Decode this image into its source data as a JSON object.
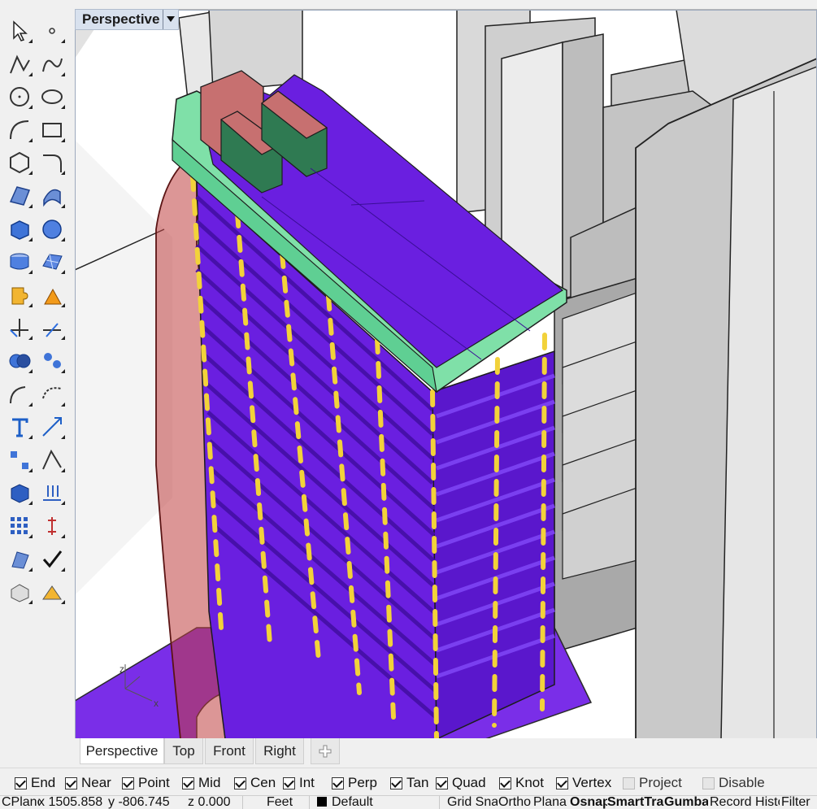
{
  "viewport": {
    "title": "Perspective"
  },
  "toolbar": {
    "tools": [
      {
        "icon": "select-arrow-icon"
      },
      {
        "icon": "point-icon"
      },
      {
        "icon": "polyline-icon"
      },
      {
        "icon": "curve-icon"
      },
      {
        "icon": "circle-icon"
      },
      {
        "icon": "ellipse-icon"
      },
      {
        "icon": "arc-icon"
      },
      {
        "icon": "rectangle-icon"
      },
      {
        "icon": "polygon-icon"
      },
      {
        "icon": "fillet-curve-icon"
      },
      {
        "icon": "surface-icon"
      },
      {
        "icon": "loft-icon"
      },
      {
        "icon": "box-icon"
      },
      {
        "icon": "sphere-icon"
      },
      {
        "icon": "cylinder-icon"
      },
      {
        "icon": "mesh-icon"
      },
      {
        "icon": "puzzle-icon"
      },
      {
        "icon": "explode-icon"
      },
      {
        "icon": "trim-icon"
      },
      {
        "icon": "split-icon"
      },
      {
        "icon": "boolean-icon"
      },
      {
        "icon": "array-icon"
      },
      {
        "icon": "offset-icon"
      },
      {
        "icon": "rotate-icon"
      },
      {
        "icon": "text-icon"
      },
      {
        "icon": "scale-icon"
      },
      {
        "icon": "group-icon"
      },
      {
        "icon": "transform-icon"
      },
      {
        "icon": "solid-edit-icon"
      },
      {
        "icon": "extrude-icon"
      },
      {
        "icon": "grid-array-icon"
      },
      {
        "icon": "dimension-icon"
      },
      {
        "icon": "analyze-icon"
      },
      {
        "icon": "check-icon"
      },
      {
        "icon": "render-icon"
      },
      {
        "icon": "light-icon"
      }
    ]
  },
  "tabs": [
    {
      "label": "Perspective",
      "active": true
    },
    {
      "label": "Top",
      "active": false
    },
    {
      "label": "Front",
      "active": false
    },
    {
      "label": "Right",
      "active": false
    }
  ],
  "add_tab_icon": "plus-icon",
  "osnaps": [
    {
      "label": "End",
      "checked": true,
      "enabled": true
    },
    {
      "label": "Near",
      "checked": true,
      "enabled": true
    },
    {
      "label": "Point",
      "checked": true,
      "enabled": true
    },
    {
      "label": "Mid",
      "checked": true,
      "enabled": true
    },
    {
      "label": "Cen",
      "checked": true,
      "enabled": true
    },
    {
      "label": "Int",
      "checked": true,
      "enabled": true
    },
    {
      "label": "Perp",
      "checked": true,
      "enabled": true
    },
    {
      "label": "Tan",
      "checked": true,
      "enabled": true
    },
    {
      "label": "Quad",
      "checked": true,
      "enabled": true
    },
    {
      "label": "Knot",
      "checked": true,
      "enabled": true
    },
    {
      "label": "Vertex",
      "checked": true,
      "enabled": true
    },
    {
      "label": "Project",
      "checked": false,
      "enabled": false
    },
    {
      "label": "Disable",
      "checked": false,
      "enabled": false
    }
  ],
  "status": {
    "cplane": "CPlane",
    "x": "x 1505.858",
    "y": "y -806.745",
    "z": "z 0.000",
    "units": "Feet",
    "layer": "Default",
    "layer_color": "#000000",
    "grid_snap": "Grid Snap",
    "ortho": "Ortho",
    "planar": "Planar",
    "osnap": "Osnap",
    "smart_track": "SmartTrack",
    "gumball": "Gumball",
    "record_history": "Record History",
    "filter": "Filter"
  },
  "colors": {
    "building_purple": "#6a1fe0",
    "roof_green": "#7fe0a8",
    "mech_red": "#c77070",
    "glass_red": "#c0504d",
    "mullion_yellow": "#f2d23a",
    "context_gray": "#c8c8c8"
  }
}
